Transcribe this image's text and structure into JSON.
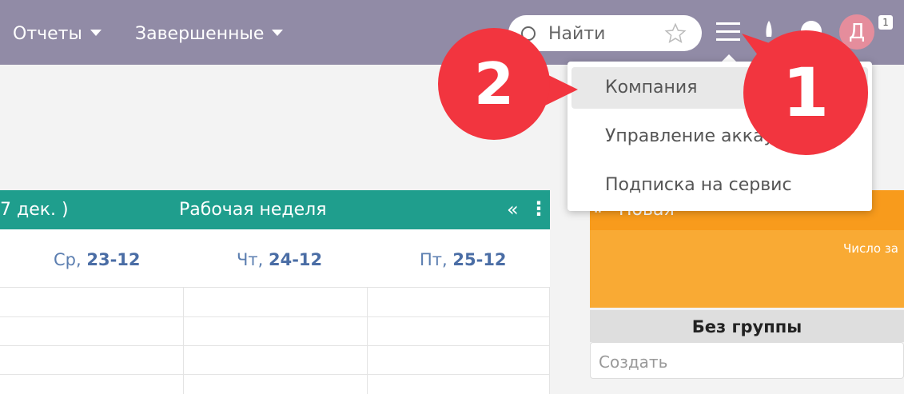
{
  "nav": {
    "reports": "Отчеты",
    "completed": "Завершенные"
  },
  "search": {
    "placeholder": "Найти"
  },
  "user": {
    "initial": "Д",
    "notifications": "1"
  },
  "dropdown": {
    "items": [
      "Компания",
      "Управление аккаунтом",
      "Подписка на сервис"
    ]
  },
  "calendar": {
    "range": "7 дек. )",
    "view": "Рабочая неделя",
    "days": [
      {
        "weekday": "Ср, ",
        "date": "23-12"
      },
      {
        "weekday": "Чт, ",
        "date": "24-12"
      },
      {
        "weekday": "Пт, ",
        "date": "25-12"
      }
    ]
  },
  "kanban": {
    "column": "Новая",
    "count_label": "Число за",
    "group": "Без группы",
    "create_placeholder": "Создать"
  },
  "callouts": {
    "first": "1",
    "second": "2"
  },
  "colors": {
    "topbar": "#918ba6",
    "calendar_header": "#1f9e8d",
    "kanban": "#f89b1c",
    "callout": "#f2353f"
  }
}
